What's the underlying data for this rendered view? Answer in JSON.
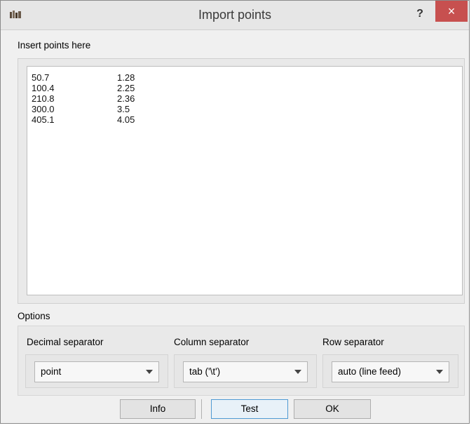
{
  "window": {
    "title": "Import points",
    "help_label": "?",
    "close_label": "×"
  },
  "insert": {
    "label": "Insert points here",
    "rows": [
      [
        "50.7",
        "1.28"
      ],
      [
        "100.4",
        "2.25"
      ],
      [
        "210.8",
        "2.36"
      ],
      [
        "300.0",
        "3.5"
      ],
      [
        "405.1",
        "4.05"
      ]
    ]
  },
  "options": {
    "label": "Options",
    "decimal": {
      "label": "Decimal separator",
      "value": "point"
    },
    "column": {
      "label": "Column separator",
      "value": "tab ('\\t')"
    },
    "row": {
      "label": "Row separator",
      "value": "auto (line feed)"
    }
  },
  "buttons": {
    "info": "Info",
    "test": "Test",
    "ok": "OK"
  },
  "colors": {
    "close_bg": "#c7504f",
    "accent": "#4f9ad3"
  },
  "icons": {
    "app": "app-icon",
    "help": "help-icon",
    "close": "close-icon",
    "dropdown": "chevron-down-icon"
  }
}
